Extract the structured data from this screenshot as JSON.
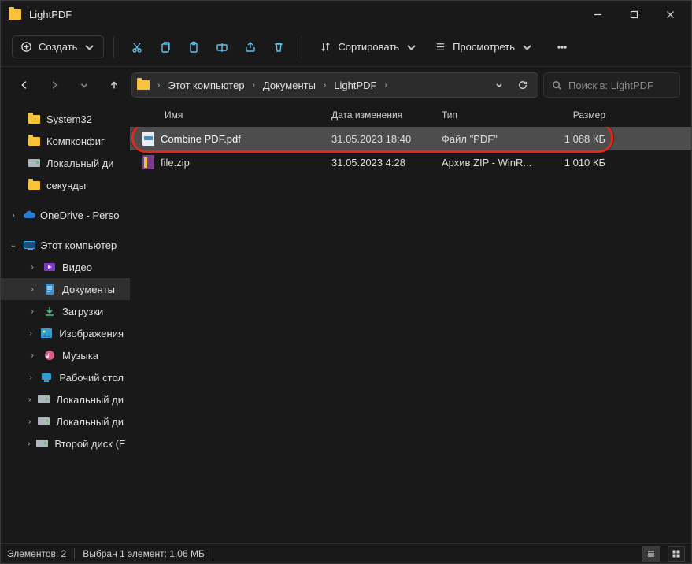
{
  "window": {
    "title": "LightPDF"
  },
  "toolbar": {
    "create": "Создать",
    "sort": "Сортировать",
    "view": "Просмотреть"
  },
  "breadcrumbs": [
    "Этот компьютер",
    "Документы",
    "LightPDF"
  ],
  "search": {
    "placeholder": "Поиск в: LightPDF"
  },
  "columns": {
    "name": "Имя",
    "date": "Дата изменения",
    "type": "Тип",
    "size": "Размер"
  },
  "sidebar": {
    "items": [
      {
        "label": "System32",
        "icon": "folder"
      },
      {
        "label": "Компконфиг",
        "icon": "folder"
      },
      {
        "label": "Локальный ди",
        "icon": "drive"
      },
      {
        "label": "секунды",
        "icon": "folder"
      }
    ],
    "onedrive": "OneDrive - Perso",
    "thispc": "Этот компьютер",
    "pcitems": [
      {
        "label": "Видео",
        "kind": "video"
      },
      {
        "label": "Документы",
        "kind": "doc",
        "active": true
      },
      {
        "label": "Загрузки",
        "kind": "dl"
      },
      {
        "label": "Изображения",
        "kind": "img"
      },
      {
        "label": "Музыка",
        "kind": "music"
      },
      {
        "label": "Рабочий стол",
        "kind": "desk"
      },
      {
        "label": "Локальный ди",
        "kind": "drive"
      },
      {
        "label": "Локальный ди",
        "kind": "drive"
      },
      {
        "label": "Второй диск (E",
        "kind": "drive"
      }
    ]
  },
  "files": [
    {
      "name": "Combine PDF.pdf",
      "date": "31.05.2023 18:40",
      "type": "Файл \"PDF\"",
      "size": "1 088 КБ",
      "icon": "pdf",
      "selected": true
    },
    {
      "name": "file.zip",
      "date": "31.05.2023 4:28",
      "type": "Архив ZIP - WinR...",
      "size": "1 010 КБ",
      "icon": "zip",
      "selected": false
    }
  ],
  "status": {
    "count": "Элементов: 2",
    "selection": "Выбран 1 элемент: 1,06 МБ"
  }
}
